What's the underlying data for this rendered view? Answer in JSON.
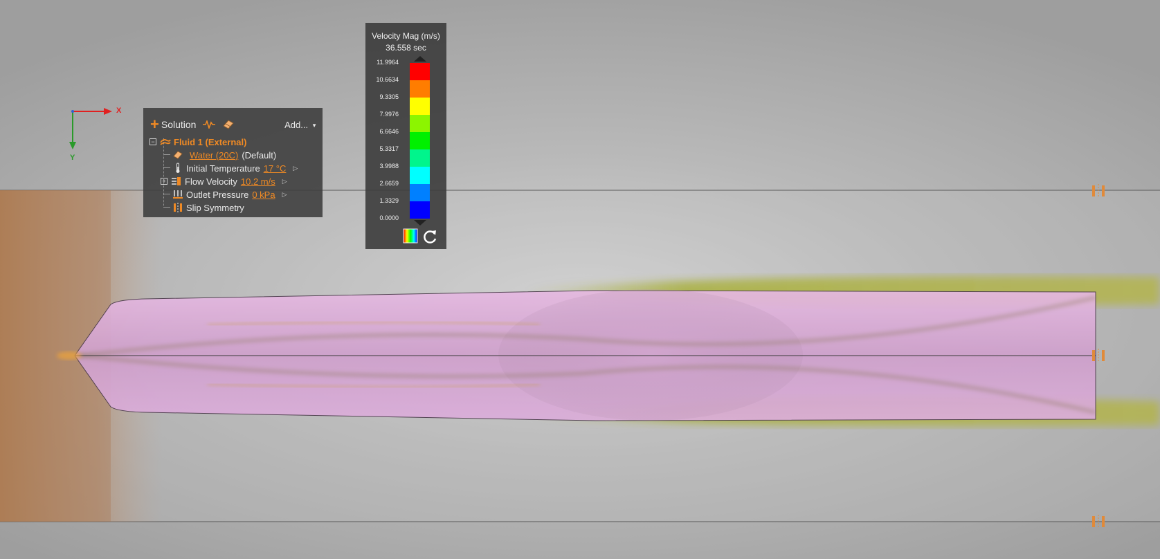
{
  "axis_triad": {
    "x_label": "X",
    "y_label": "Y"
  },
  "solution_panel": {
    "header_label": "Solution",
    "header_icons": [
      "waveform-icon",
      "material-eraser-icon"
    ],
    "add_label": "Add...",
    "fluid": {
      "label": "Fluid 1 (External)",
      "icon": "fluid-flow-icon"
    },
    "material": {
      "name": "Water (20C)",
      "suffix": "(Default)",
      "icon": "material-icon"
    },
    "initial_temperature": {
      "label": "Initial Temperature",
      "value": "17 °C",
      "icon": "thermometer-icon"
    },
    "flow_velocity": {
      "label": "Flow Velocity",
      "value": "10.2 m/s",
      "icon": "flow-velocity-icon"
    },
    "outlet_pressure": {
      "label": "Outlet Pressure",
      "value": "0 kPa",
      "icon": "outlet-pressure-icon"
    },
    "slip_symmetry": {
      "label": "Slip Symmetry",
      "icon": "slip-symmetry-icon"
    }
  },
  "legend": {
    "title": "Velocity Mag (m/s)",
    "time": "36.558 sec",
    "ticks": [
      "11.9964",
      "10.6634",
      "9.3305",
      "7.9976",
      "6.6646",
      "5.3317",
      "3.9988",
      "2.6659",
      "1.3329",
      "0.0000"
    ],
    "colors": [
      "#ff0000",
      "#ff7d00",
      "#ffff00",
      "#8cf500",
      "#00f000",
      "#00f58c",
      "#00ffff",
      "#0080ff",
      "#0000ff"
    ],
    "icons": [
      "palette-icon",
      "reset-icon"
    ]
  },
  "accent_color": "#f08a24"
}
